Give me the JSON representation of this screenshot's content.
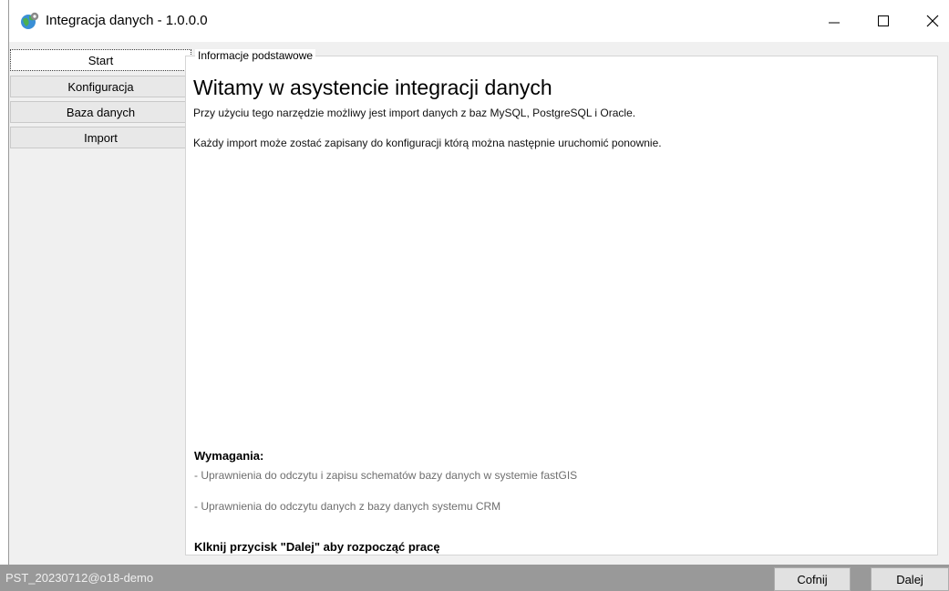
{
  "window": {
    "title": "Integracja danych - 1.0.0.0"
  },
  "nav": {
    "items": [
      {
        "label": "Start",
        "active": true
      },
      {
        "label": "Konfiguracja",
        "active": false
      },
      {
        "label": "Baza danych",
        "active": false
      },
      {
        "label": "Import",
        "active": false
      }
    ]
  },
  "main": {
    "group_label": "Informacje podstawowe",
    "heading": "Witamy w asystencie integracji danych",
    "paragraphs": [
      "Przy użyciu tego narzędzie możliwy jest import danych z baz MySQL, PostgreSQL i Oracle.",
      "Każdy import może zostać zapisany do konfiguracji którą można następnie uruchomić ponownie."
    ],
    "requirements_title": "Wymagania:",
    "requirements": [
      "- Uprawnienia do odczytu i zapisu schematów bazy danych w systemie fastGIS",
      "- Uprawnienia do odczytu danych z bazy danych systemu CRM"
    ],
    "cta": "Klknij przycisk \"Dalej\" aby rozpocząć pracę"
  },
  "footer": {
    "status": "PST_20230712@o18-demo",
    "back_label": "Cofnij",
    "next_label": "Dalej"
  },
  "icons": {
    "app": "globe-gear-icon",
    "minimize": "minimize-icon",
    "maximize": "maximize-icon",
    "close": "close-icon"
  }
}
